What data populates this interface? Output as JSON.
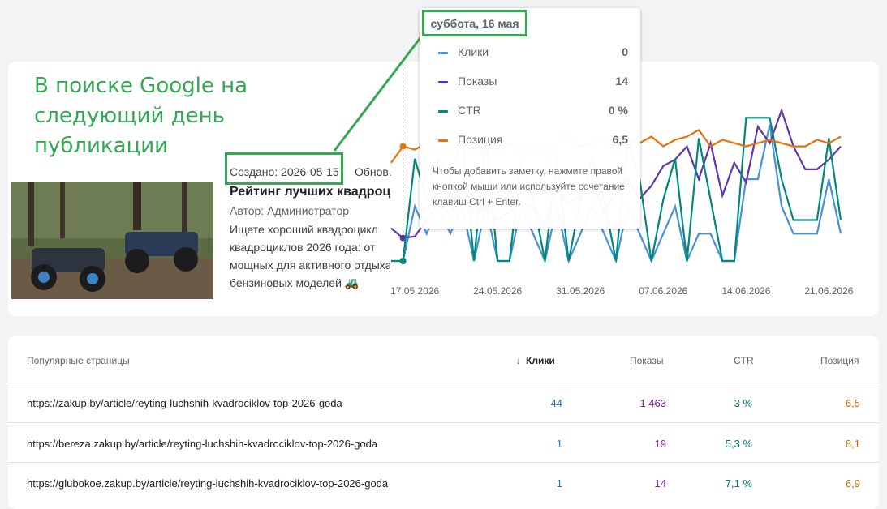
{
  "annotation": {
    "text": "В поиске Google на следующий день публикации"
  },
  "article": {
    "created_label": "Создано:",
    "created_date": "2026-05-15",
    "updated_label": "Обнов.",
    "title": "Рейтинг лучших квадроциклов",
    "author": "Автор: Администратор",
    "description_lines": [
      "Ищете хороший квадроцикл",
      "квадроциклов 2026 года: от",
      "мощных для активного отдыха",
      "бензиновых моделей 🚜"
    ]
  },
  "tooltip": {
    "date": "суббота, 16 мая",
    "metrics": [
      {
        "label": "Клики",
        "value": "0",
        "color": "#4a90d9"
      },
      {
        "label": "Показы",
        "value": "14",
        "color": "#5e35b1"
      },
      {
        "label": "CTR",
        "value": "0 %",
        "color": "#00897b"
      },
      {
        "label": "Позиция",
        "value": "6,5",
        "color": "#e8710a"
      }
    ],
    "note": "Чтобы добавить заметку, нажмите правой кнопкой мыши или используйте сочетание клавиш Ctrl + Enter."
  },
  "chart_data": {
    "type": "line",
    "x": [
      "15.05.2026",
      "16.05.2026",
      "17.05.2026",
      "18.05.2026",
      "19.05.2026",
      "20.05.2026",
      "21.05.2026",
      "22.05.2026",
      "23.05.2026",
      "24.05.2026",
      "25.05.2026",
      "26.05.2026",
      "27.05.2026",
      "28.05.2026",
      "29.05.2026",
      "30.05.2026",
      "31.05.2026",
      "01.06.2026",
      "02.06.2026",
      "03.06.2026",
      "04.06.2026",
      "05.06.2026",
      "06.06.2026",
      "07.06.2026",
      "08.06.2026",
      "09.06.2026",
      "10.06.2026",
      "11.06.2026",
      "12.06.2026",
      "13.06.2026",
      "14.06.2026",
      "15.06.2026",
      "16.06.2026",
      "17.06.2026",
      "18.06.2026",
      "19.06.2026",
      "20.06.2026",
      "21.06.2026",
      "22.06.2026"
    ],
    "x_tick_labels": [
      "17.05.2026",
      "24.05.2026",
      "31.05.2026",
      "07.06.2026",
      "14.06.2026",
      "21.06.2026"
    ],
    "series": [
      {
        "name": "Клики",
        "color": "#4a90d9",
        "values": [
          0,
          0,
          2,
          1,
          2,
          1,
          2,
          0,
          2,
          0,
          0,
          2,
          1,
          0,
          2,
          0,
          1,
          2,
          1,
          0,
          2,
          1,
          0,
          1,
          2,
          0,
          1,
          1,
          0,
          0,
          3,
          3,
          5,
          2,
          1,
          1,
          1,
          3,
          1
        ]
      },
      {
        "name": "Показы",
        "color": "#5e35b1",
        "values": [
          20,
          14,
          15,
          25,
          35,
          28,
          40,
          30,
          33,
          25,
          30,
          36,
          32,
          22,
          45,
          35,
          40,
          48,
          30,
          42,
          50,
          38,
          46,
          58,
          62,
          70,
          50,
          72,
          40,
          60,
          48,
          82,
          72,
          92,
          70,
          56,
          56,
          62,
          70
        ]
      },
      {
        "name": "CTR",
        "color": "#00897b",
        "values": [
          0,
          0,
          5,
          3,
          5,
          4,
          6,
          0,
          6,
          0,
          0,
          5,
          3,
          0,
          5,
          0,
          3,
          5,
          3,
          0,
          6,
          4,
          0,
          3,
          5,
          0,
          6,
          3,
          0,
          0,
          7,
          7,
          7,
          4,
          2,
          2,
          2,
          6,
          2
        ]
      },
      {
        "name": "Позиция",
        "color": "#e8710a",
        "values": [
          7,
          6.5,
          6.6,
          6.4,
          6.6,
          6.7,
          6.3,
          6.8,
          6.5,
          6.6,
          6.4,
          6.7,
          6.5,
          6.6,
          6.4,
          6.3,
          6.5,
          6.4,
          6.3,
          6.6,
          6.3,
          6.4,
          6.2,
          6.5,
          6.3,
          6.2,
          6.0,
          6.5,
          6.3,
          6.4,
          6.5,
          6.4,
          6.3,
          6.4,
          6.5,
          6.5,
          6.3,
          6.4,
          6.2
        ]
      }
    ],
    "grid": false
  },
  "table": {
    "headers": {
      "page": "Популярные страницы",
      "clicks": "Клики",
      "impressions": "Показы",
      "ctr": "CTR",
      "position": "Позиция"
    },
    "sort_icon": "arrow-down-icon",
    "rows": [
      {
        "url": "https://zakup.by/article/reyting-luchshih-kvadrociklov-top-2026-goda",
        "clicks": "44",
        "impressions": "1 463",
        "ctr": "3 %",
        "position": "6,5"
      },
      {
        "url": "https://bereza.zakup.by/article/reyting-luchshih-kvadrociklov-top-2026-goda",
        "clicks": "1",
        "impressions": "19",
        "ctr": "5,3 %",
        "position": "8,1"
      },
      {
        "url": "https://glubokoe.zakup.by/article/reyting-luchshih-kvadrociklov-top-2026-goda",
        "clicks": "1",
        "impressions": "14",
        "ctr": "7,1 %",
        "position": "6,9"
      }
    ]
  }
}
